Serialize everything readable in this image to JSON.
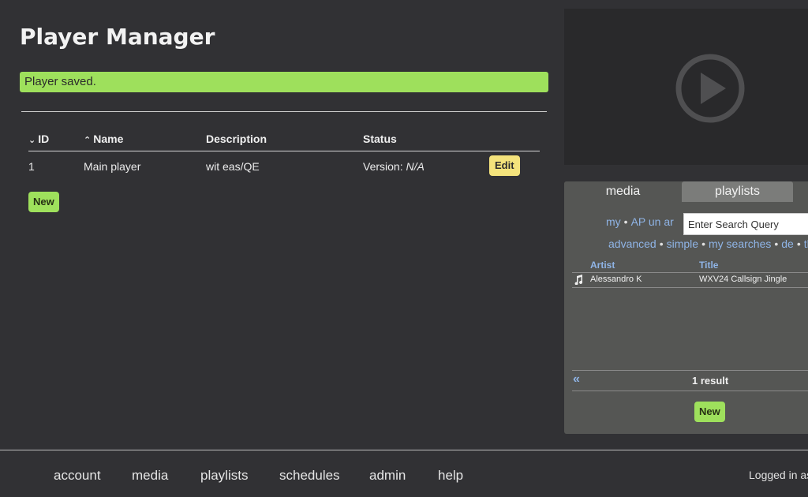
{
  "page": {
    "title": "Player Manager",
    "flash_message": "Player saved."
  },
  "players_table": {
    "headers": {
      "id": "ID",
      "name": "Name",
      "description": "Description",
      "status": "Status"
    },
    "sort_indicators": {
      "id": "desc",
      "name": "asc"
    },
    "rows": [
      {
        "id": "1",
        "name": "Main player",
        "description": "wit eas/QE",
        "status_label": "Version:",
        "status_value": "N/A",
        "edit_label": "Edit"
      }
    ],
    "new_label": "New"
  },
  "sidebar": {
    "tabs": {
      "media": "media",
      "playlists": "playlists"
    },
    "search_scope": {
      "my": "my",
      "other": "AP un ar"
    },
    "search_placeholder": "Enter Search Query",
    "search_modes": [
      "advanced",
      "simple",
      "my searches",
      "de",
      "th"
    ],
    "results": {
      "headers": {
        "artist": "Artist",
        "title": "Title"
      },
      "rows": [
        {
          "artist": "Alessandro K",
          "title": "WXV24 Callsign Jingle",
          "icon": "music-note-icon"
        }
      ],
      "count_label": "1 result",
      "prev_symbol": "«"
    },
    "new_label": "New"
  },
  "footer": {
    "nav": [
      "account",
      "media",
      "playlists",
      "schedules",
      "admin",
      "help"
    ],
    "logged_in_text": "Logged in as"
  },
  "colors": {
    "background": "#313134",
    "flash": "#9ee05c",
    "edit_button": "#f4e37c",
    "link": "#8fb4e6",
    "panel": "#555654"
  }
}
